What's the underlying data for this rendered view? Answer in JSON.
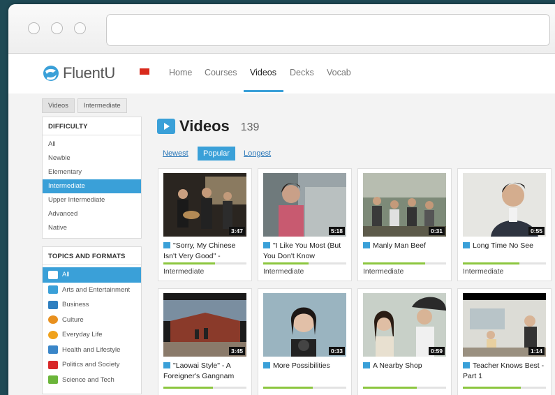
{
  "nav": {
    "logo_text": "FluentU",
    "items": [
      "Home",
      "Courses",
      "Videos",
      "Decks",
      "Vocab"
    ],
    "active": "Videos"
  },
  "breadcrumb": [
    "Videos",
    "Intermediate"
  ],
  "difficulty": {
    "header": "DIFFICULTY",
    "items": [
      "All",
      "Newbie",
      "Elementary",
      "Intermediate",
      "Upper Intermediate",
      "Advanced",
      "Native"
    ],
    "selected": "Intermediate"
  },
  "topics": {
    "header": "TOPICS AND FORMATS",
    "items": [
      {
        "label": "All",
        "icon": "video-icon"
      },
      {
        "label": "Arts and Entertainment",
        "icon": "arts-icon"
      },
      {
        "label": "Business",
        "icon": "briefcase-icon"
      },
      {
        "label": "Culture",
        "icon": "culture-icon"
      },
      {
        "label": "Everyday Life",
        "icon": "clock-icon"
      },
      {
        "label": "Health and Lifestyle",
        "icon": "health-icon"
      },
      {
        "label": "Politics and Society",
        "icon": "flag-icon"
      },
      {
        "label": "Science and Tech",
        "icon": "science-icon"
      }
    ],
    "selected": "All"
  },
  "main": {
    "title": "Videos",
    "count": "139",
    "sort_options": [
      "Newest",
      "Popular",
      "Longest"
    ],
    "sort_selected": "Popular"
  },
  "videos": [
    {
      "title": "\"Sorry, My Chinese Isn't Very Good\" -",
      "duration": "3:47",
      "level": "Intermediate",
      "progress": 0.62
    },
    {
      "title": "\"I Like You Most (But You Don't Know",
      "duration": "5:18",
      "level": "Intermediate",
      "progress": 0.55
    },
    {
      "title": "Manly Man Beef",
      "duration": "0:31",
      "level": "Intermediate",
      "progress": 0.75
    },
    {
      "title": "Long Time No See",
      "duration": "0:55",
      "level": "Intermediate",
      "progress": 0.68
    },
    {
      "title": "\"Laowai Style\" - A Foreigner's Gangnam",
      "duration": "3:45",
      "level": "",
      "progress": 0.6
    },
    {
      "title": "More Possibilities",
      "duration": "0:33",
      "level": "",
      "progress": 0.6
    },
    {
      "title": "A Nearby Shop",
      "duration": "0:59",
      "level": "",
      "progress": 0.65
    },
    {
      "title": "Teacher Knows Best - Part 1",
      "duration": "1:14",
      "level": "",
      "progress": 0.7
    }
  ],
  "colors": {
    "accent": "#3aa0d8",
    "progress": "#8cc63f",
    "flag": "#d92a1c"
  }
}
